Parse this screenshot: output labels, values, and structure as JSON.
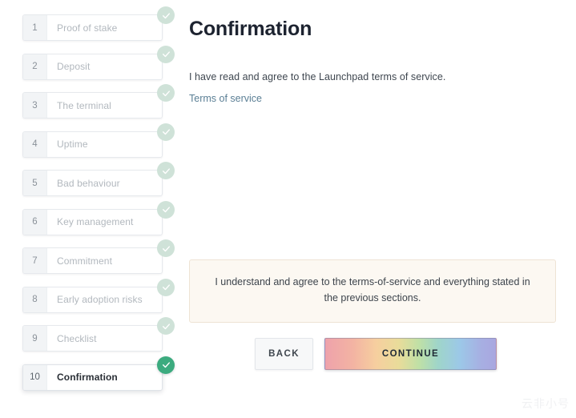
{
  "stepper": {
    "steps": [
      {
        "number": "1",
        "label": "Proof of stake",
        "state": "completed"
      },
      {
        "number": "2",
        "label": "Deposit",
        "state": "completed"
      },
      {
        "number": "3",
        "label": "The terminal",
        "state": "completed"
      },
      {
        "number": "4",
        "label": "Uptime",
        "state": "completed"
      },
      {
        "number": "5",
        "label": "Bad behaviour",
        "state": "completed"
      },
      {
        "number": "6",
        "label": "Key management",
        "state": "completed"
      },
      {
        "number": "7",
        "label": "Commitment",
        "state": "completed"
      },
      {
        "number": "8",
        "label": "Early adoption risks",
        "state": "completed"
      },
      {
        "number": "9",
        "label": "Checklist",
        "state": "completed"
      },
      {
        "number": "10",
        "label": "Confirmation",
        "state": "active"
      }
    ],
    "check_icon": "check-icon",
    "badge_color_completed": "#cfe2d8",
    "badge_color_active": "#3cab7f"
  },
  "main": {
    "title": "Confirmation",
    "intro_text": "I have read and agree to the Launchpad terms of service.",
    "terms_link_label": "Terms of service",
    "terms_link_color": "#5b7f95",
    "notice": {
      "text": "I understand and agree to the terms-of-service and everything stated in the previous sections.",
      "background": "#fcf8f2",
      "border_color": "#eee3d4"
    },
    "buttons": {
      "back_label": "BACK",
      "continue_label": "CONTINUE"
    }
  },
  "watermark": {
    "text": "云非小号"
  }
}
